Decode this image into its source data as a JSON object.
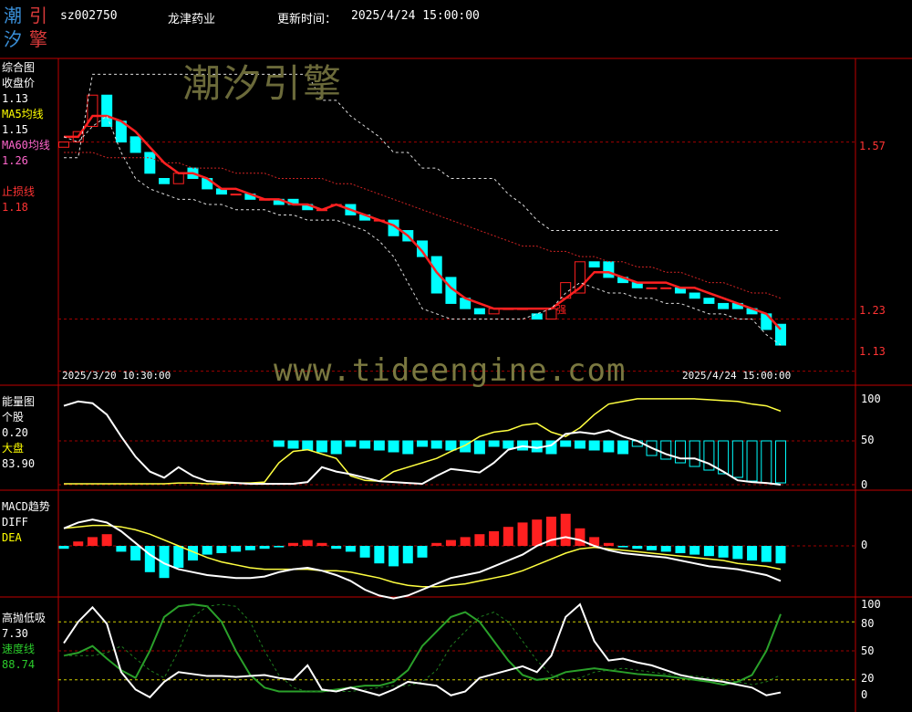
{
  "header": {
    "logo_chars": [
      "潮",
      "引",
      "汐",
      "擎"
    ],
    "code": "sz002750",
    "name": "龙津药业",
    "update_label": "更新时间：",
    "update_time": "2025/4/24 15:00:00"
  },
  "watermark": {
    "brand": "潮汐引擎",
    "url": "www.tideengine.com"
  },
  "panels": {
    "price": {
      "title": "综合图",
      "close_label": "收盘价",
      "close_value": "1.13",
      "ma5_label": "MA5均线",
      "ma5_value": "1.15",
      "ma60_label": "MA60均线",
      "ma60_value": "1.26",
      "stop_label": "止损线",
      "stop_value": "1.18",
      "axis": [
        "1.57",
        "1.23",
        "1.13"
      ],
      "start_time": "2025/3/20 10:30:00",
      "end_time": "2025/4/24 15:00:00",
      "marker": "强"
    },
    "energy": {
      "title": "能量图",
      "stock_label": "个股",
      "stock_value": "0.20",
      "market_label": "大盘",
      "market_value": "83.90",
      "axis": [
        "100",
        "50",
        "0"
      ]
    },
    "macd": {
      "title": "MACD趋势",
      "diff_label": "DIFF",
      "dea_label": "DEA",
      "axis": [
        "0"
      ]
    },
    "hilo": {
      "title": "高抛低吸",
      "value": "7.30",
      "speed_label": "速度线",
      "speed_value": "88.74",
      "axis": [
        "100",
        "80",
        "50",
        "20",
        "0"
      ]
    }
  },
  "colors": {
    "up": "#ff2020",
    "down": "#00ffff",
    "ma5": "#ff2020",
    "ma60": "#cc2222",
    "stop": "#ffffff",
    "grid": "#8b0000",
    "yellow": "#ffff40",
    "green": "#2aa02a"
  },
  "chart_data": [
    {
      "type": "candlestick",
      "title": "综合图",
      "x_start": "2025/3/20 10:30:00",
      "x_end": "2025/4/24 15:00:00",
      "ylim": [
        1.11,
        1.72
      ],
      "series": [
        {
          "name": "收盘价",
          "open": [
            1.56,
            1.57,
            1.6,
            1.66,
            1.61,
            1.58,
            1.55,
            1.5,
            1.49,
            1.52,
            1.5,
            1.48,
            1.47,
            1.47,
            1.46,
            1.46,
            1.46,
            1.45,
            1.44,
            1.45,
            1.45,
            1.43,
            1.42,
            1.42,
            1.4,
            1.38,
            1.35,
            1.31,
            1.27,
            1.25,
            1.24,
            1.25,
            1.25,
            1.24,
            1.23,
            1.27,
            1.28,
            1.34,
            1.34,
            1.31,
            1.3,
            1.29,
            1.29,
            1.29,
            1.28,
            1.27,
            1.26,
            1.26,
            1.25,
            1.24,
            1.22
          ],
          "close": [
            1.57,
            1.59,
            1.66,
            1.6,
            1.57,
            1.55,
            1.51,
            1.49,
            1.51,
            1.5,
            1.48,
            1.47,
            1.47,
            1.46,
            1.46,
            1.45,
            1.45,
            1.44,
            1.44,
            1.45,
            1.43,
            1.42,
            1.42,
            1.39,
            1.38,
            1.35,
            1.28,
            1.26,
            1.25,
            1.24,
            1.25,
            1.25,
            1.25,
            1.23,
            1.25,
            1.3,
            1.34,
            1.33,
            1.31,
            1.3,
            1.29,
            1.29,
            1.29,
            1.28,
            1.27,
            1.26,
            1.25,
            1.25,
            1.24,
            1.21,
            1.18
          ]
        },
        {
          "name": "MA5均线",
          "values": [
            1.58,
            1.58,
            1.62,
            1.62,
            1.61,
            1.59,
            1.56,
            1.53,
            1.51,
            1.51,
            1.5,
            1.48,
            1.48,
            1.47,
            1.46,
            1.46,
            1.45,
            1.45,
            1.44,
            1.45,
            1.44,
            1.43,
            1.42,
            1.41,
            1.39,
            1.36,
            1.32,
            1.29,
            1.27,
            1.26,
            1.25,
            1.25,
            1.25,
            1.25,
            1.25,
            1.27,
            1.29,
            1.32,
            1.32,
            1.31,
            1.3,
            1.3,
            1.3,
            1.29,
            1.29,
            1.28,
            1.27,
            1.26,
            1.25,
            1.24,
            1.21
          ]
        },
        {
          "name": "MA60均线",
          "values": [
            1.55,
            1.55,
            1.55,
            1.54,
            1.54,
            1.54,
            1.54,
            1.53,
            1.53,
            1.52,
            1.52,
            1.52,
            1.51,
            1.51,
            1.51,
            1.5,
            1.5,
            1.5,
            1.5,
            1.49,
            1.49,
            1.48,
            1.47,
            1.46,
            1.45,
            1.44,
            1.43,
            1.42,
            1.41,
            1.4,
            1.39,
            1.38,
            1.37,
            1.37,
            1.36,
            1.36,
            1.35,
            1.35,
            1.34,
            1.34,
            1.33,
            1.33,
            1.32,
            1.32,
            1.31,
            1.3,
            1.3,
            1.29,
            1.28,
            1.28,
            1.27
          ]
        }
      ]
    },
    {
      "type": "line",
      "title": "能量图",
      "ylim": [
        0,
        100
      ],
      "series": [
        {
          "name": "个股",
          "values": [
            90,
            95,
            93,
            80,
            55,
            32,
            15,
            8,
            20,
            10,
            4,
            3,
            2,
            1,
            1,
            1,
            1,
            3,
            20,
            15,
            12,
            8,
            4,
            3,
            2,
            1,
            10,
            18,
            16,
            14,
            25,
            40,
            44,
            42,
            45,
            58,
            60,
            58,
            62,
            55,
            50,
            42,
            35,
            30,
            30,
            24,
            15,
            5,
            3,
            2,
            0
          ]
        },
        {
          "name": "大盘",
          "values": [
            1,
            1,
            1,
            1,
            1,
            1,
            1,
            1,
            2,
            2,
            1,
            1,
            2,
            2,
            3,
            25,
            38,
            40,
            35,
            30,
            10,
            5,
            4,
            15,
            20,
            25,
            30,
            38,
            45,
            55,
            60,
            62,
            68,
            70,
            60,
            55,
            65,
            80,
            92,
            95,
            98,
            98,
            98,
            98,
            98,
            97,
            96,
            95,
            92,
            90,
            84
          ]
        }
      ]
    },
    {
      "type": "bar+line",
      "title": "MACD趋势",
      "ylim": [
        -0.05,
        0.03
      ],
      "series": [
        {
          "name": "MACD",
          "values": [
            -0.002,
            0.003,
            0.006,
            0.008,
            -0.004,
            -0.01,
            -0.018,
            -0.022,
            -0.015,
            -0.01,
            -0.006,
            -0.005,
            -0.004,
            -0.003,
            -0.002,
            -0.001,
            0.002,
            0.004,
            0.002,
            -0.002,
            -0.004,
            -0.008,
            -0.012,
            -0.014,
            -0.012,
            -0.008,
            0.002,
            0.004,
            0.006,
            0.008,
            0.01,
            0.013,
            0.016,
            0.018,
            0.02,
            0.022,
            0.012,
            0.006,
            0.002,
            -0.001,
            -0.002,
            -0.003,
            -0.004,
            -0.005,
            -0.006,
            -0.007,
            -0.008,
            -0.009,
            -0.01,
            -0.011,
            -0.012
          ]
        },
        {
          "name": "DIFF",
          "values": [
            0.012,
            0.016,
            0.018,
            0.016,
            0.01,
            0.002,
            -0.006,
            -0.012,
            -0.016,
            -0.018,
            -0.02,
            -0.021,
            -0.022,
            -0.022,
            -0.021,
            -0.018,
            -0.016,
            -0.015,
            -0.017,
            -0.02,
            -0.024,
            -0.03,
            -0.034,
            -0.036,
            -0.034,
            -0.03,
            -0.026,
            -0.022,
            -0.02,
            -0.018,
            -0.014,
            -0.01,
            -0.006,
            0.0,
            0.004,
            0.006,
            0.004,
            0.0,
            -0.003,
            -0.005,
            -0.006,
            -0.007,
            -0.008,
            -0.01,
            -0.012,
            -0.014,
            -0.015,
            -0.016,
            -0.018,
            -0.02,
            -0.024
          ]
        },
        {
          "name": "DEA",
          "values": [
            0.012,
            0.013,
            0.014,
            0.014,
            0.013,
            0.011,
            0.008,
            0.004,
            0.0,
            -0.004,
            -0.008,
            -0.011,
            -0.013,
            -0.015,
            -0.016,
            -0.016,
            -0.016,
            -0.016,
            -0.017,
            -0.017,
            -0.018,
            -0.02,
            -0.022,
            -0.025,
            -0.027,
            -0.028,
            -0.028,
            -0.027,
            -0.026,
            -0.024,
            -0.022,
            -0.02,
            -0.017,
            -0.013,
            -0.009,
            -0.005,
            -0.002,
            -0.001,
            -0.002,
            -0.003,
            -0.004,
            -0.005,
            -0.006,
            -0.007,
            -0.008,
            -0.009,
            -0.01,
            -0.012,
            -0.013,
            -0.014,
            -0.016
          ]
        }
      ]
    },
    {
      "type": "line",
      "title": "高抛低吸",
      "ylim": [
        0,
        100
      ],
      "series": [
        {
          "name": "高抛低吸",
          "values": [
            58,
            80,
            95,
            78,
            28,
            10,
            2,
            18,
            28,
            26,
            24,
            24,
            23,
            24,
            25,
            22,
            20,
            35,
            10,
            8,
            12,
            8,
            4,
            10,
            18,
            16,
            14,
            4,
            8,
            22,
            26,
            30,
            34,
            28,
            45,
            85,
            98,
            60,
            40,
            42,
            38,
            35,
            30,
            25,
            22,
            20,
            18,
            15,
            12,
            4,
            7
          ]
        },
        {
          "name": "速度线",
          "values": [
            45,
            48,
            55,
            42,
            30,
            22,
            50,
            85,
            96,
            98,
            96,
            80,
            50,
            25,
            12,
            8,
            8,
            8,
            8,
            10,
            12,
            14,
            14,
            18,
            30,
            55,
            70,
            85,
            90,
            80,
            60,
            40,
            25,
            20,
            22,
            28,
            30,
            32,
            30,
            28,
            26,
            25,
            24,
            22,
            20,
            18,
            15,
            18,
            25,
            50,
            88
          ]
        }
      ]
    }
  ]
}
